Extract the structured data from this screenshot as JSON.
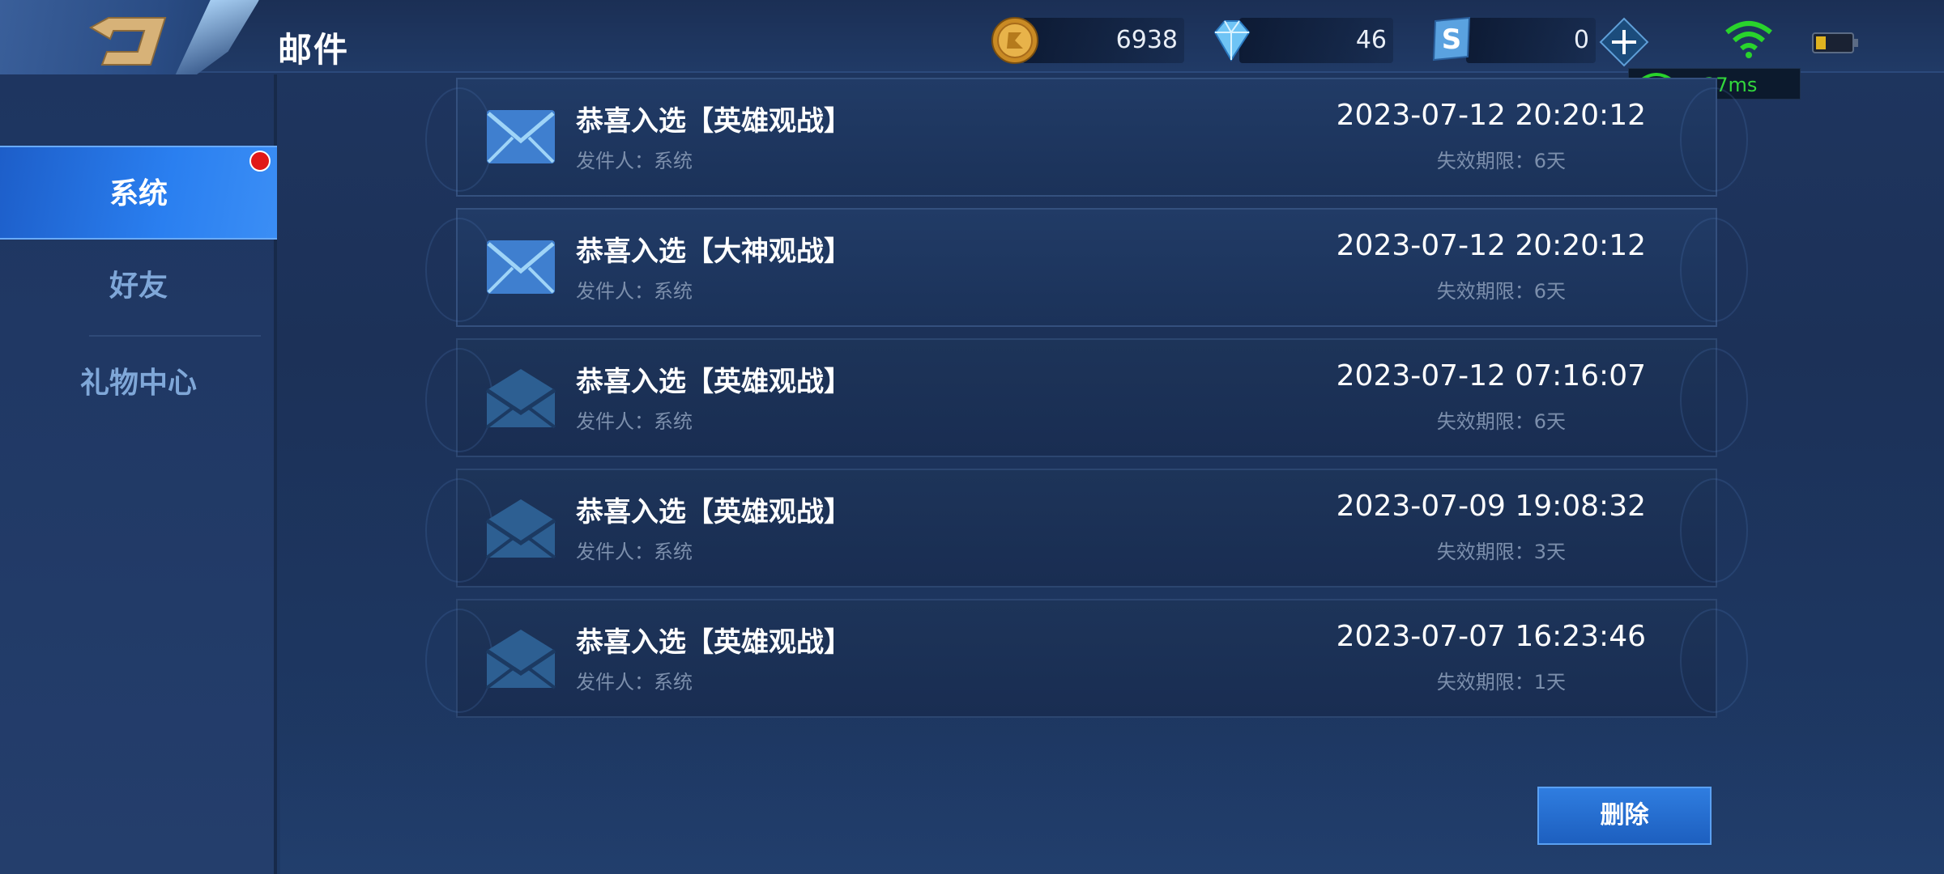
{
  "header": {
    "title": "邮件",
    "currencies": [
      {
        "icon": "gold-coin-icon",
        "amount": "6938"
      },
      {
        "icon": "diamond-icon",
        "amount": "46"
      },
      {
        "icon": "s-coupon-icon",
        "amount": "0"
      }
    ],
    "ping": "37ms"
  },
  "sidebar": {
    "items": [
      {
        "label": "系统",
        "active": true,
        "badge": true
      },
      {
        "label": "好友",
        "active": false
      },
      {
        "label": "礼物中心",
        "active": false
      }
    ]
  },
  "mails": [
    {
      "subject": "恭喜入选【英雄观战】",
      "sender": "发件人：系统",
      "time": "2023-07-12 20:20:12",
      "expire": "失效期限：6天",
      "read": false
    },
    {
      "subject": "恭喜入选【大神观战】",
      "sender": "发件人：系统",
      "time": "2023-07-12 20:20:12",
      "expire": "失效期限：6天",
      "read": false
    },
    {
      "subject": "恭喜入选【英雄观战】",
      "sender": "发件人：系统",
      "time": "2023-07-12 07:16:07",
      "expire": "失效期限：6天",
      "read": true
    },
    {
      "subject": "恭喜入选【英雄观战】",
      "sender": "发件人：系统",
      "time": "2023-07-09 19:08:32",
      "expire": "失效期限：3天",
      "read": true
    },
    {
      "subject": "恭喜入选【英雄观战】",
      "sender": "发件人：系统",
      "time": "2023-07-07 16:23:46",
      "expire": "失效期限：1天",
      "read": true
    }
  ],
  "actions": {
    "delete_label": "删除"
  },
  "colors": {
    "accent": "#2a7ff0",
    "badge": "#e01818",
    "ping": "#32d83c"
  }
}
